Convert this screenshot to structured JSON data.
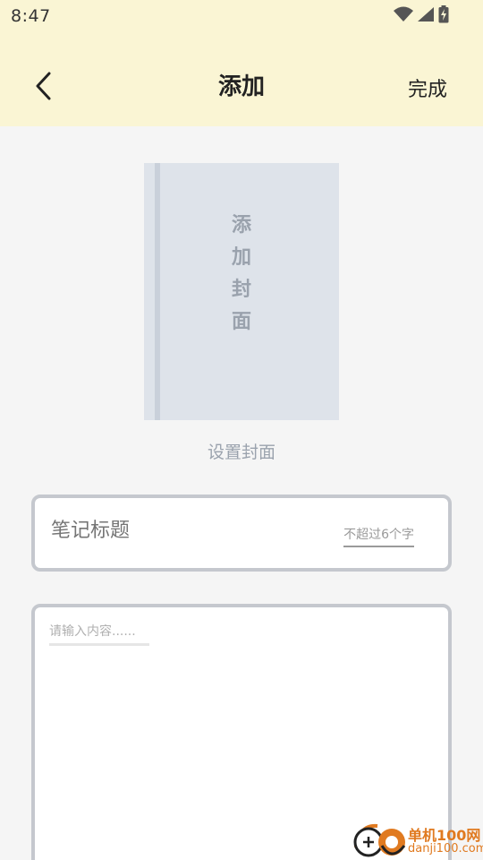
{
  "status_bar": {
    "time": "8:47",
    "icons": [
      "wifi-icon",
      "signal-icon",
      "battery-charging-icon"
    ]
  },
  "app_bar": {
    "back_icon": "chevron-left-icon",
    "title": "添加",
    "done_label": "完成"
  },
  "cover": {
    "placeholder_chars": [
      "添",
      "加",
      "封",
      "面"
    ],
    "label": "设置封面"
  },
  "note_title": {
    "placeholder": "笔记标题",
    "hint": "不超过6个字"
  },
  "note_content": {
    "placeholder": "请输入内容......"
  },
  "watermark": {
    "cn": "单机100网",
    "en": "danji100.com"
  },
  "colors": {
    "header_bg": "#faf5d4",
    "page_bg": "#f5f5f5",
    "cover_bg": "#dee3ea",
    "cover_text": "#9aa2ad",
    "field_border": "#c5c8ce",
    "watermark": "#e07a20"
  }
}
